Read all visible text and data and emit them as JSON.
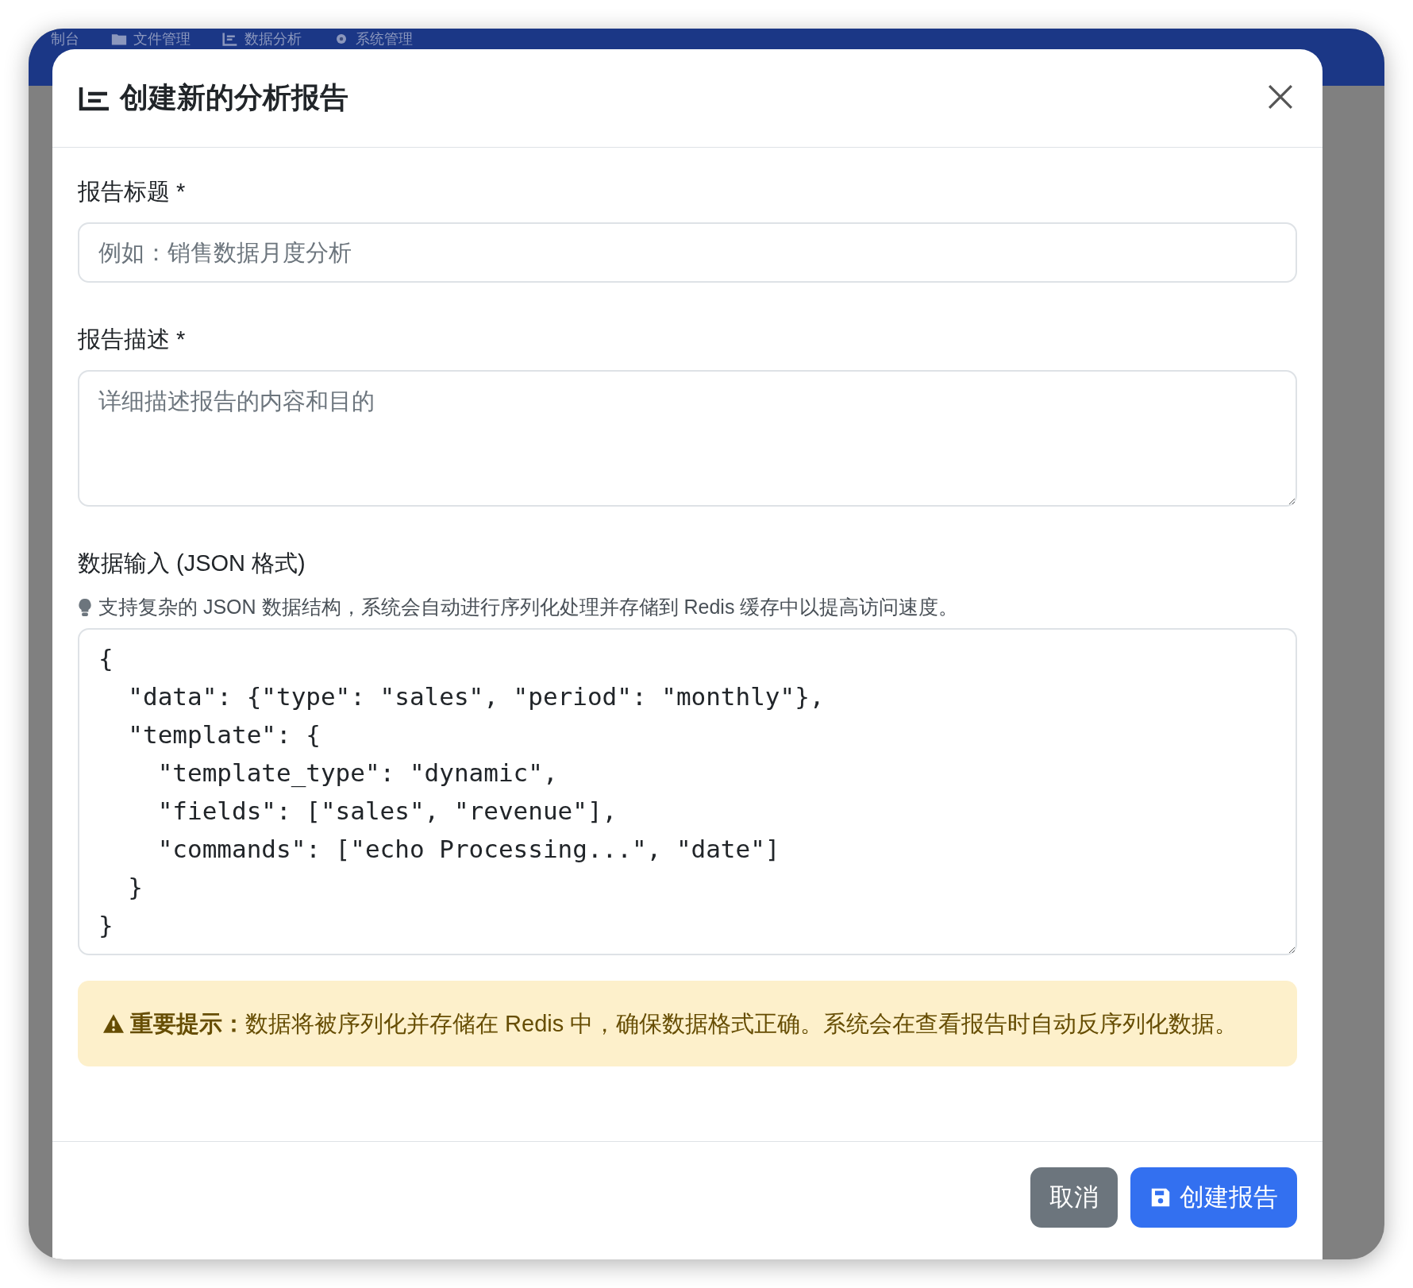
{
  "nav": {
    "items": [
      {
        "label": "制台"
      },
      {
        "label": "文件管理"
      },
      {
        "label": "数据分析"
      },
      {
        "label": "系统管理"
      }
    ]
  },
  "dialog": {
    "title": "创建新的分析报告",
    "fields": [
      {
        "kind": "input",
        "label": "报告标题 *",
        "placeholder": "例如：销售数据月度分析"
      },
      {
        "kind": "textarea",
        "label": "报告描述 *",
        "placeholder": "详细描述报告的内容和目的"
      },
      {
        "kind": "code",
        "label": "数据输入 (JSON 格式)",
        "hint": "支持复杂的 JSON 数据结构，系统会自动进行序列化处理并存储到 Redis 缓存中以提高访问速度。",
        "value": "{\n  \"data\": {\"type\": \"sales\", \"period\": \"monthly\"},\n  \"template\": {\n    \"template_type\": \"dynamic\",\n    \"fields\": [\"sales\", \"revenue\"],\n    \"commands\": [\"echo Processing...\", \"date\"]\n  }\n}"
      }
    ],
    "warning": "**重要提示：**数据将被序列化并存储在 Redis 中，确保数据格式正确。系统会在查看报告时自动反序列化数据。",
    "buttons": [
      {
        "kind": "secondary",
        "label": "取消"
      },
      {
        "kind": "primary",
        "label": "创建报告"
      }
    ]
  }
}
